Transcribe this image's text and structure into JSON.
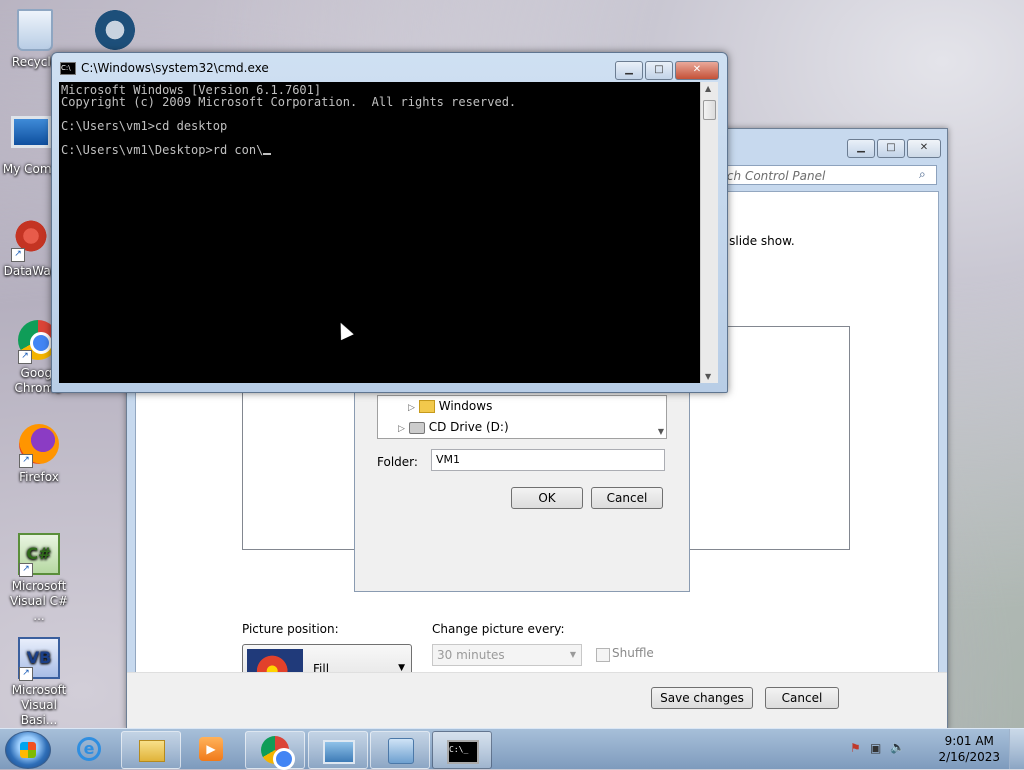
{
  "desktop": {
    "icons": [
      {
        "label": "Recycle"
      },
      {
        "label": "My Comp"
      },
      {
        "label": "DataWag"
      },
      {
        "label": "Googl Chrome"
      },
      {
        "label": "Firefox"
      },
      {
        "label": "Microsoft Visual C# ..."
      },
      {
        "label": "Microsoft Visual Basi..."
      }
    ]
  },
  "cmd": {
    "title": "C:\\Windows\\system32\\cmd.exe",
    "icon_label": "C:\\",
    "lines": [
      "Microsoft Windows [Version 6.1.7601]",
      "Copyright (c) 2009 Microsoft Corporation.  All rights reserved.",
      "C:\\Users\\vm1>cd desktop",
      "C:\\Users\\vm1\\Desktop>rd con\\"
    ],
    "buttons": {
      "minimize": "▁",
      "maximize": "□",
      "close": "✕"
    }
  },
  "control_panel": {
    "search_placeholder": "rch Control Panel",
    "instruction_fragment": "a slide show.",
    "buttons": {
      "minimize": "▁",
      "maximize": "□",
      "close": "✕"
    },
    "browse_dialog": {
      "tree_items": [
        {
          "label": "Windows"
        },
        {
          "label": "CD Drive (D:)"
        }
      ],
      "folder_label": "Folder:",
      "folder_value": "VM1",
      "ok_label": "OK",
      "cancel_label": "Cancel"
    },
    "picture_position_label": "Picture position:",
    "picture_position_value": "Fill",
    "change_picture_label": "Change picture every:",
    "change_picture_value": "30 minutes",
    "shuffle_label": "Shuffle",
    "save_label": "Save changes",
    "cancel_label": "Cancel"
  },
  "taskbar": {
    "items": [
      {
        "name": "internet-explorer"
      },
      {
        "name": "windows-explorer"
      },
      {
        "name": "media-player"
      },
      {
        "name": "chrome"
      },
      {
        "name": "control-panel-personalization"
      },
      {
        "name": "remote-desktop"
      },
      {
        "name": "command-prompt"
      }
    ],
    "clock_time": "9:01 AM",
    "clock_date": "2/16/2023"
  }
}
